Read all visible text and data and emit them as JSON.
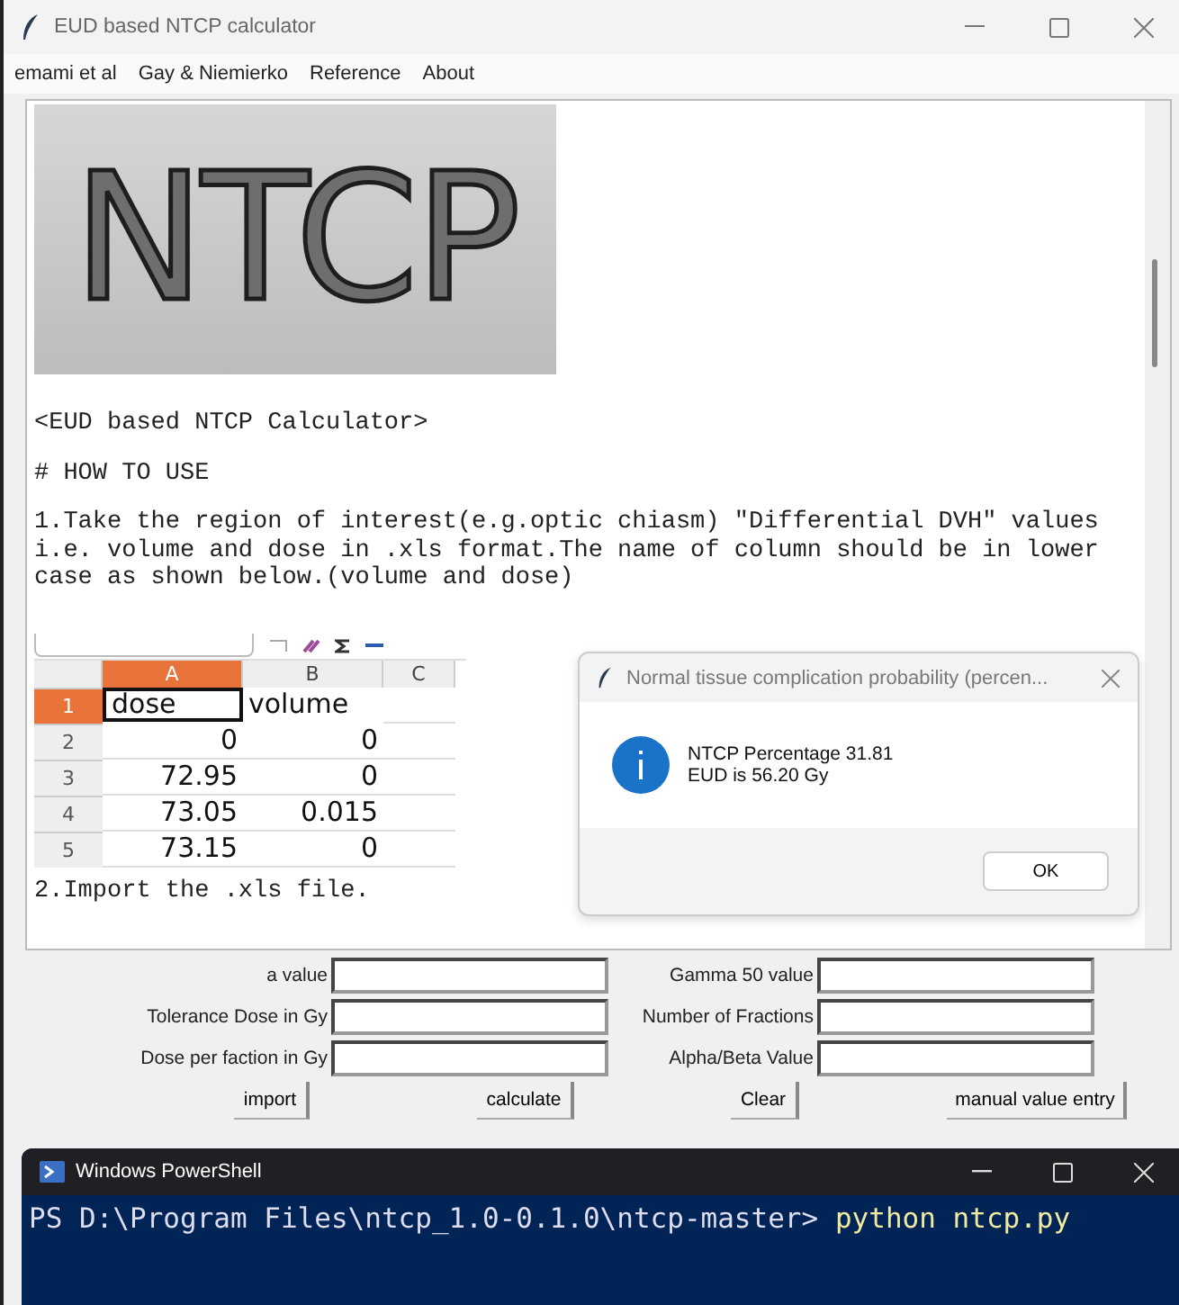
{
  "window": {
    "title": "EUD based NTCP calculator"
  },
  "menu": [
    "emami et al",
    "Gay & Niemierko",
    "Reference",
    "About"
  ],
  "logo": {
    "text": "NTCP"
  },
  "instructions": [
    "<EUD based NTCP Calculator>",
    "# HOW TO USE",
    "1.Take the region of interest(e.g.optic chiasm) \"Differential DVH\" values\ni.e. volume and dose in .xls format.The name of column should be in lower\ncase as shown below.(volume and dose)"
  ],
  "spreadsheet": {
    "columns": [
      {
        "label": "A",
        "selected": true
      },
      {
        "label": "B",
        "selected": false
      },
      {
        "label": "C",
        "selected": false
      }
    ],
    "rows": [
      {
        "number": "1",
        "selected": true,
        "cells": [
          "dose",
          "volume"
        ]
      },
      {
        "number": "2",
        "selected": false,
        "cells": [
          "0",
          "0"
        ]
      },
      {
        "number": "3",
        "selected": false,
        "cells": [
          "72.95",
          "0"
        ]
      },
      {
        "number": "4",
        "selected": false,
        "cells": [
          "73.05",
          "0.015"
        ]
      },
      {
        "number": "5",
        "selected": false,
        "cells": [
          "73.15",
          "0"
        ]
      }
    ]
  },
  "step_2": "2.Import the .xls file.",
  "dialog": {
    "title": "Normal tissue complication probability (percen...",
    "lines": [
      "NTCP Percentage 31.81",
      "EUD is 56.20 Gy"
    ],
    "button": "OK"
  },
  "fields": [
    {
      "label": "a value"
    },
    {
      "label": "Gamma 50 value"
    },
    {
      "label": "Tolerance Dose in Gy"
    },
    {
      "label": "Number of Fractions"
    },
    {
      "label": "Dose per faction in Gy"
    },
    {
      "label": "Alpha/Beta Value"
    }
  ],
  "buttons": [
    "import",
    "calculate",
    "Clear",
    "manual value entry"
  ],
  "terminal": {
    "title": "Windows PowerShell",
    "prompt": "PS D:\\Program Files\\ntcp_1.0-0.1.0\\ntcp-master>",
    "command": "python ntcp.py"
  }
}
